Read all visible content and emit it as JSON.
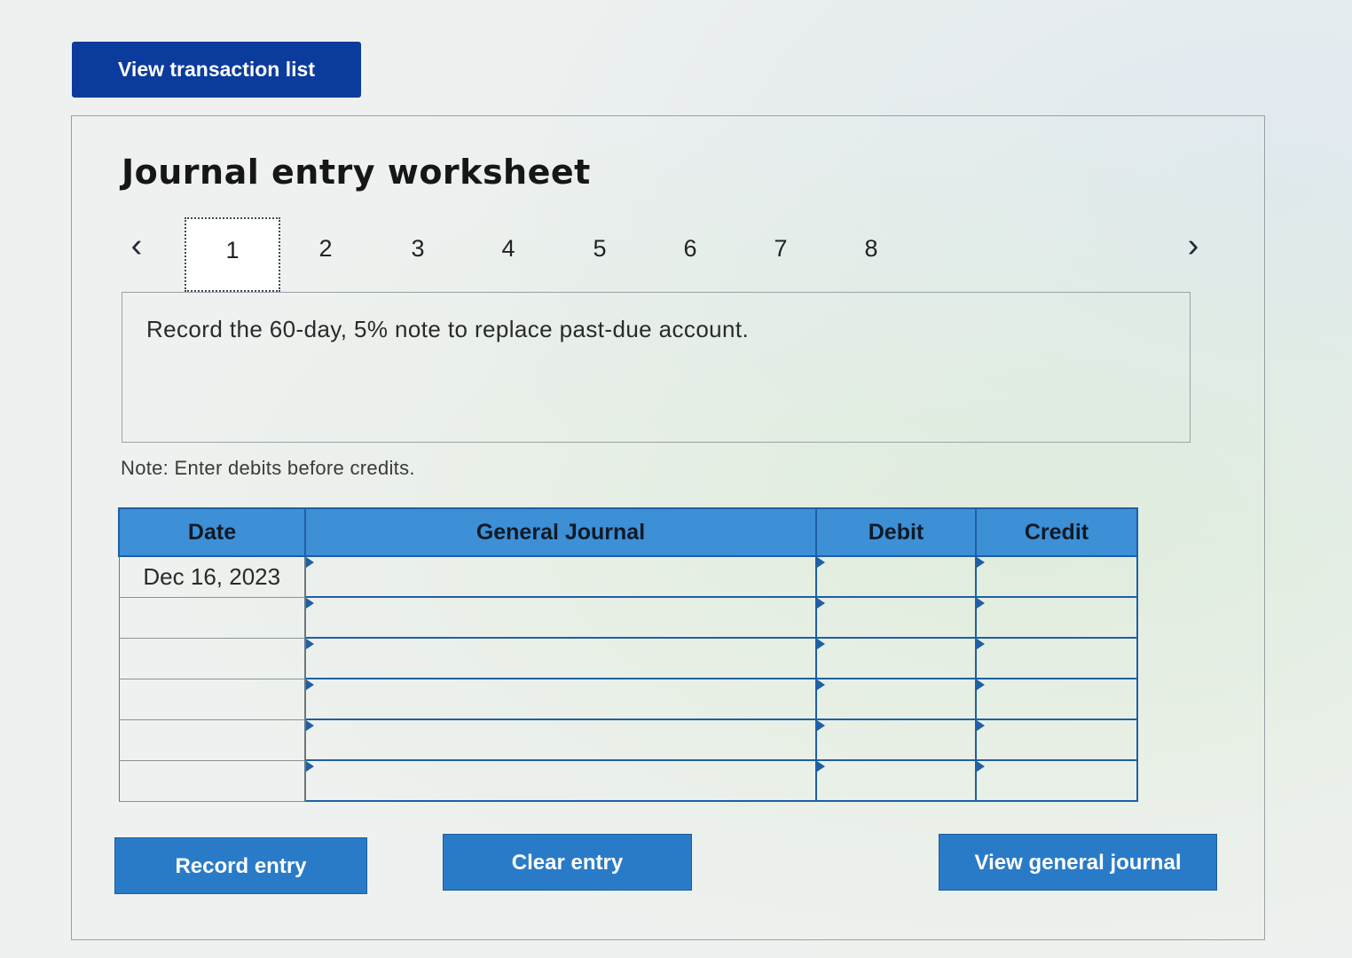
{
  "toolbar": {
    "view_transactions_label": "View transaction list"
  },
  "worksheet": {
    "title": "Journal entry worksheet",
    "pager": {
      "pages": [
        "1",
        "2",
        "3",
        "4",
        "5",
        "6",
        "7",
        "8"
      ],
      "active_page": "1",
      "prev_icon": "chevron-left",
      "next_icon": "chevron-right"
    },
    "instruction": "Record the 60-day, 5% note to replace past-due account.",
    "note": "Note: Enter debits before credits."
  },
  "journal_table": {
    "columns": [
      "Date",
      "General Journal",
      "Debit",
      "Credit"
    ],
    "rows": [
      {
        "date": "Dec 16, 2023",
        "account": "",
        "debit": "",
        "credit": ""
      },
      {
        "date": "",
        "account": "",
        "debit": "",
        "credit": ""
      },
      {
        "date": "",
        "account": "",
        "debit": "",
        "credit": ""
      },
      {
        "date": "",
        "account": "",
        "debit": "",
        "credit": ""
      },
      {
        "date": "",
        "account": "",
        "debit": "",
        "credit": ""
      },
      {
        "date": "",
        "account": "",
        "debit": "",
        "credit": ""
      }
    ]
  },
  "actions": {
    "record_label": "Record entry",
    "clear_label": "Clear entry",
    "view_journal_label": "View general journal"
  },
  "colors": {
    "primary_dark": "#0b3b9c",
    "header_blue": "#3d8fd6",
    "button_blue": "#2a7bc7",
    "table_border": "#1e5fa6"
  }
}
